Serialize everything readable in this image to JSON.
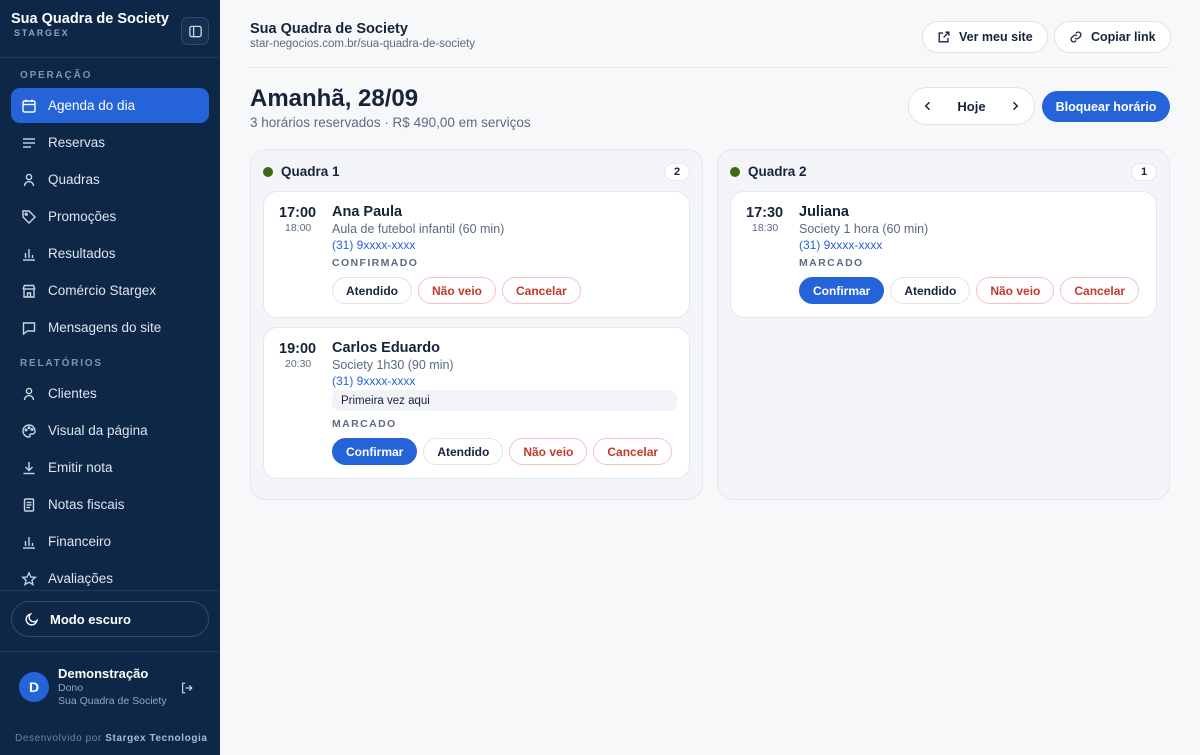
{
  "brand": {
    "title": "Sua Quadra de Society",
    "subtitle": "STARGEX"
  },
  "sidebar": {
    "section_operation": "OPERAÇÃO",
    "section_reports": "RELATÓRIOS",
    "operation_items": [
      {
        "label": "Agenda do dia",
        "icon": "calendar-icon",
        "active": true
      },
      {
        "label": "Reservas",
        "icon": "list-icon"
      },
      {
        "label": "Quadras",
        "icon": "user-icon"
      },
      {
        "label": "Promoções",
        "icon": "tag-icon"
      },
      {
        "label": "Resultados",
        "icon": "bar-chart-icon"
      },
      {
        "label": "Comércio Stargex",
        "icon": "store-icon"
      },
      {
        "label": "Mensagens do site",
        "icon": "message-icon"
      }
    ],
    "report_items": [
      {
        "label": "Clientes",
        "icon": "user-icon"
      },
      {
        "label": "Visual da página",
        "icon": "palette-icon"
      },
      {
        "label": "Emitir nota",
        "icon": "download-icon"
      },
      {
        "label": "Notas fiscais",
        "icon": "receipt-icon"
      },
      {
        "label": "Financeiro",
        "icon": "bar-chart-icon"
      },
      {
        "label": "Avaliações",
        "icon": "star-icon"
      }
    ],
    "dark_mode_label": "Modo escuro",
    "user": {
      "initial": "D",
      "name": "Demonstração",
      "role": "Dono",
      "company": "Sua Quadra de Society"
    },
    "footer_prefix": "Desenvolvido por",
    "footer_company": "Stargex Tecnologia"
  },
  "header": {
    "site_title": "Sua Quadra de Society",
    "site_url": "star-negocios.com.br/sua-quadra-de-society",
    "view_site_label": "Ver meu site",
    "copy_link_label": "Copiar link"
  },
  "day": {
    "title": "Amanhã, 28/09",
    "summary": "3 horários reservados · R$ 490,00 em serviços",
    "today_label": "Hoje",
    "block_label": "Bloquear horário"
  },
  "courts": [
    {
      "name": "Quadra 1",
      "count": "2",
      "dot_color": "#3d6b11",
      "bookings": [
        {
          "start": "17:00",
          "end": "18:00",
          "name": "Ana Paula",
          "service": "Aula de futebol infantil (60 min)",
          "phone": "(31) 9xxxx-xxxx",
          "note": "",
          "status": "CONFIRMADO",
          "actions": [
            {
              "label": "Atendido",
              "style": "default"
            },
            {
              "label": "Não veio",
              "style": "danger"
            },
            {
              "label": "Cancelar",
              "style": "danger"
            }
          ]
        },
        {
          "start": "19:00",
          "end": "20:30",
          "name": "Carlos Eduardo",
          "service": "Society 1h30 (90 min)",
          "phone": "(31) 9xxxx-xxxx",
          "note": "Primeira vez aqui",
          "status": "MARCADO",
          "actions": [
            {
              "label": "Confirmar",
              "style": "primary"
            },
            {
              "label": "Atendido",
              "style": "default"
            },
            {
              "label": "Não veio",
              "style": "danger"
            },
            {
              "label": "Cancelar",
              "style": "danger"
            }
          ]
        }
      ]
    },
    {
      "name": "Quadra 2",
      "count": "1",
      "dot_color": "#3d6b11",
      "bookings": [
        {
          "start": "17:30",
          "end": "18:30",
          "name": "Juliana",
          "service": "Society 1 hora (60 min)",
          "phone": "(31) 9xxxx-xxxx",
          "note": "",
          "status": "MARCADO",
          "actions": [
            {
              "label": "Confirmar",
              "style": "primary"
            },
            {
              "label": "Atendido",
              "style": "default"
            },
            {
              "label": "Não veio",
              "style": "danger"
            },
            {
              "label": "Cancelar",
              "style": "danger"
            }
          ]
        }
      ]
    }
  ],
  "colors": {
    "sidebar_bg": "#0f2747",
    "accent": "#2563d9",
    "danger": "#c5392b",
    "court_dot": "#3d6b11"
  }
}
